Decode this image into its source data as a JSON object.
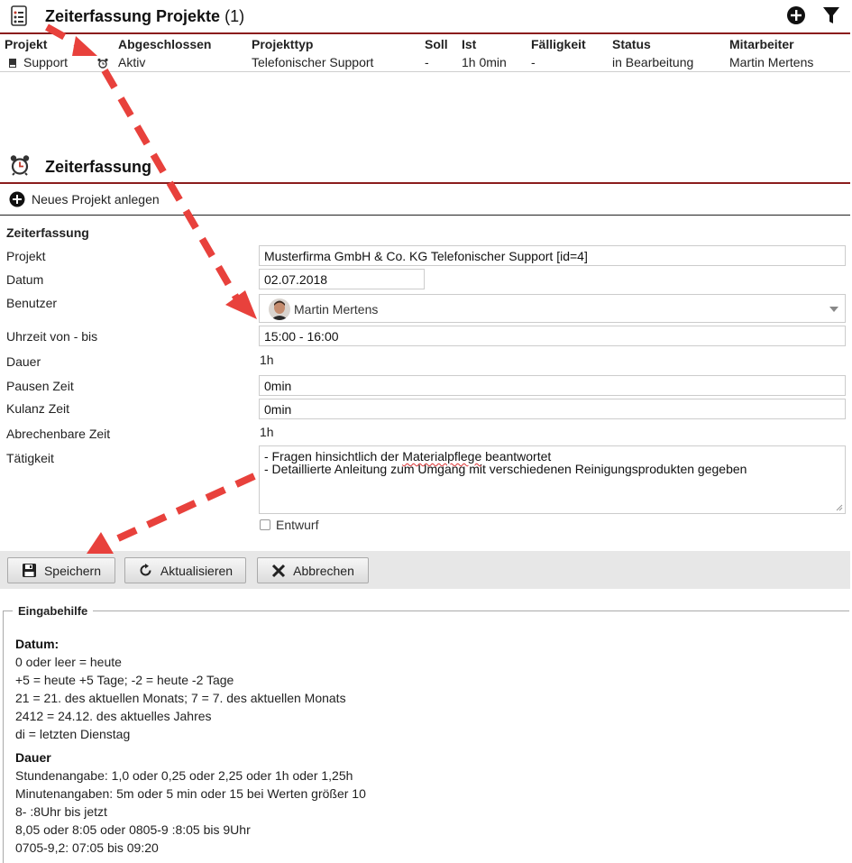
{
  "header": {
    "title": "Zeiterfassung Projekte",
    "count": "(1)",
    "icons": [
      "document-icon",
      "add-circle-icon",
      "filter-icon"
    ]
  },
  "table": {
    "columns": [
      "Projekt",
      "Abgeschlossen",
      "Projekttyp",
      "Soll",
      "Ist",
      "Fälligkeit",
      "Status",
      "Mitarbeiter"
    ],
    "rows": [
      {
        "projekt": "Support",
        "abgeschlossen": "Aktiv",
        "projekttyp": "Telefonischer Support",
        "soll": "-",
        "ist": "1h 0min",
        "faelligkeit": "-",
        "status": "in Bearbeitung",
        "mitarbeiter": "Martin Mertens"
      }
    ]
  },
  "section": {
    "title": "Zeiterfassung",
    "new_project": "Neues Projekt anlegen"
  },
  "form": {
    "title": "Zeiterfassung",
    "labels": {
      "projekt": "Projekt",
      "datum": "Datum",
      "benutzer": "Benutzer",
      "uhrzeit": "Uhrzeit von - bis",
      "dauer": "Dauer",
      "pausen": "Pausen Zeit",
      "kulanz": "Kulanz Zeit",
      "abrechenbar": "Abrechenbare Zeit",
      "taetigkeit": "Tätigkeit"
    },
    "values": {
      "projekt": "Musterfirma GmbH & Co. KG Telefonischer Support [id=4]",
      "datum": "02.07.2018",
      "benutzer": "Martin Mertens",
      "uhrzeit": "15:00 - 16:00",
      "dauer": "1h",
      "pausen": "0min",
      "kulanz": "0min",
      "abrechenbar": "1h",
      "taetigkeit_line1_a": "- Fragen hinsichtlich der ",
      "taetigkeit_line1_b": "Materialpflege",
      "taetigkeit_line1_c": " beantwortet",
      "taetigkeit_line2": "- Detaillierte Anleitung zum Umgang mit verschiedenen Reinigungsprodukten gegeben"
    },
    "draft_label": "Entwurf",
    "draft_checked": false
  },
  "buttons": {
    "save": "Speichern",
    "refresh": "Aktualisieren",
    "cancel": "Abbrechen"
  },
  "help": {
    "legend": "Eingabehilfe",
    "datum_title": "Datum:",
    "datum_lines": [
      "0 oder leer = heute",
      "+5 = heute +5 Tage; -2 = heute -2 Tage",
      "21 = 21. des aktuellen Monats; 7 = 7. des aktuellen Monats",
      "2412 = 24.12. des aktuelles Jahres",
      "di = letzten Dienstag"
    ],
    "dauer_title": "Dauer",
    "dauer_lines": [
      "Stundenangabe: 1,0 oder 0,25 oder 2,25 oder 1h oder 1,25h",
      "Minutenangaben: 5m oder 5 min oder 15 bei Werten größer 10",
      "8- :8Uhr bis jetzt",
      "8,05 oder 8:05 oder 0805-9 :8:05 bis 9Uhr",
      "0705-9,2: 07:05 bis 09:20"
    ]
  },
  "colors": {
    "accent_line": "#8b1d1d",
    "annotation_arrow": "#e8413c",
    "button_bar": "#e7e7e7"
  }
}
